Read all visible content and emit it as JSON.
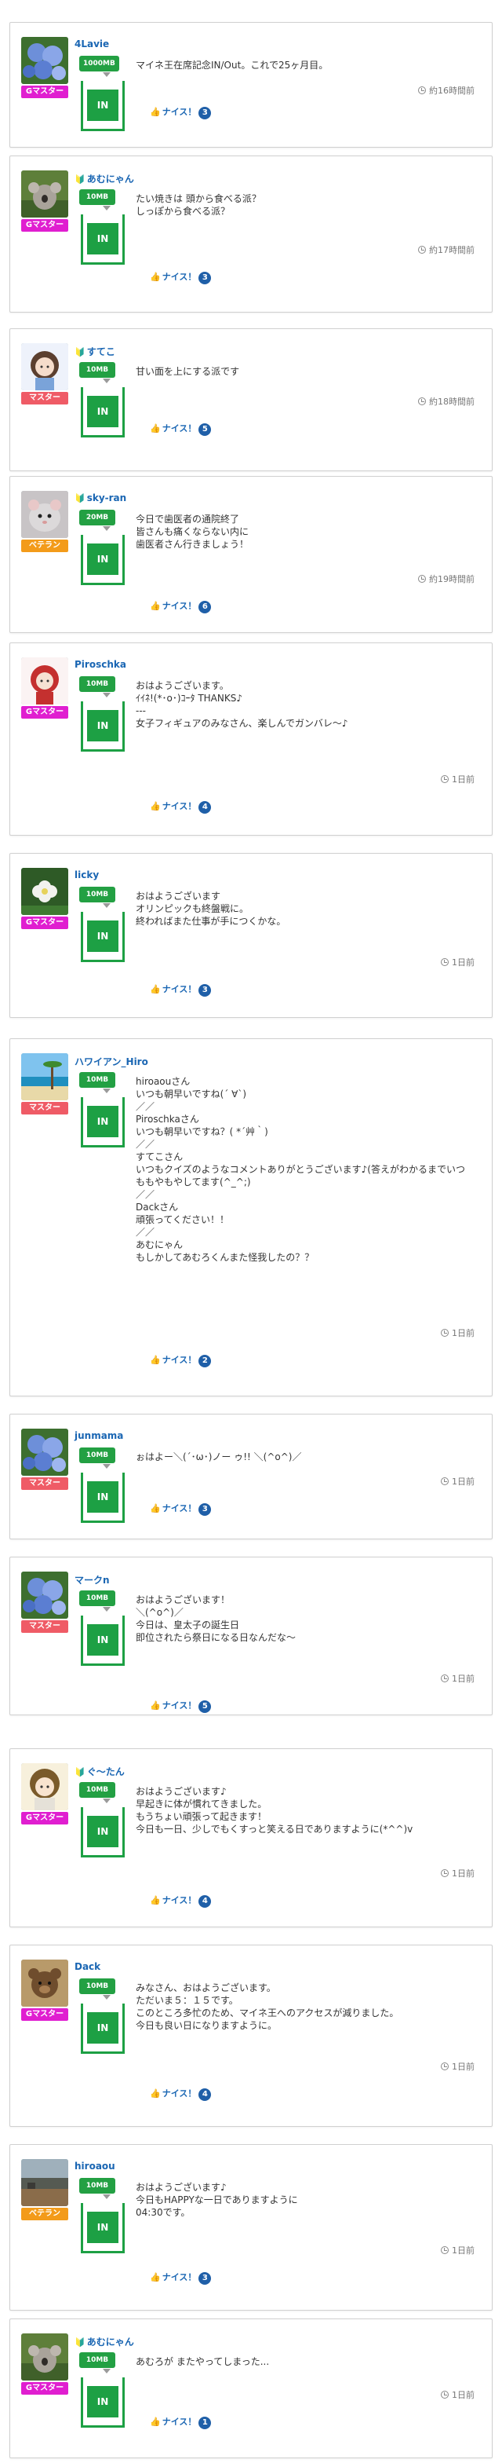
{
  "colors": {
    "in_green": "#1da044",
    "rank_gmaster": "#e01ed0",
    "rank_master": "#ef5b66",
    "rank_veteran": "#f39b1a",
    "link_blue": "#1a66b3"
  },
  "nice_label": "ナイス！",
  "in_label": "IN",
  "posts": [
    {
      "user": "4Lavie",
      "leaf": false,
      "rank": "Gマスター",
      "rank_type": "gmaster",
      "badge": "1000MB",
      "avatar": "hydrangea",
      "message": "マイネ王在席記念IN/Out。これで25ヶ月目。",
      "time": "約16時間前",
      "nice": "3"
    },
    {
      "user": "あむにゃん",
      "leaf": true,
      "rank": "Gマスター",
      "rank_type": "gmaster",
      "badge": "10MB",
      "avatar": "koala",
      "message": "たい焼きは 頭から食べる派？\nしっぽから食べる派？",
      "time": "約17時間前",
      "nice": "3"
    },
    {
      "user": "すてこ",
      "leaf": true,
      "rank": "マスター",
      "rank_type": "master",
      "badge": "10MB",
      "avatar": "girl",
      "message": "甘い面を上にする派です",
      "time": "約18時間前",
      "nice": "5"
    },
    {
      "user": "sky-ran",
      "leaf": true,
      "rank": "ベテラン",
      "rank_type": "veteran",
      "badge": "20MB",
      "avatar": "hamster",
      "message": "今日で歯医者の通院終了\n皆さんも痛くならない内に\n歯医者さん行きましょう！",
      "time": "約19時間前",
      "nice": "6"
    },
    {
      "user": "Piroschka",
      "leaf": false,
      "rank": "Gマスター",
      "rank_type": "gmaster",
      "badge": "10MB",
      "avatar": "doll",
      "message": "おはようございます。\nｲｲﾈ!(*･o･)ｺｰﾀ THANKS♪\n---\n女子フィギュアのみなさん、楽しんでガンバレ〜♪",
      "time": "1日前",
      "nice": "4"
    },
    {
      "user": "licky",
      "leaf": false,
      "rank": "Gマスター",
      "rank_type": "gmaster",
      "badge": "10MB",
      "avatar": "flower",
      "message": "おはようございます\nオリンピックも終盤戦に。\n終わればまた仕事が手につくかな。",
      "time": "1日前",
      "nice": "3"
    },
    {
      "user": "ハワイアン_Hiro",
      "leaf": false,
      "rank": "マスター",
      "rank_type": "master",
      "badge": "10MB",
      "avatar": "beach",
      "message": "hiroaouさん\nいつも朝早いですね(´ ∀`)\n／／\nPiroschkaさん\nいつも朝早いですね？( *´艸｀)\n／／\nすてこさん\nいつもクイズのようなコメントありがとうございます♪(答えがわかるまでいつももやもやしてます(^_^;)\n／／\nDackさん\n頑張ってください！！\n／／\nあむにゃん\nもしかしてあむろくんまた怪我したの？？",
      "time": "1日前",
      "nice": "2"
    },
    {
      "user": "junmama",
      "leaf": false,
      "rank": "マスター",
      "rank_type": "master",
      "badge": "10MB",
      "avatar": "hydrangea",
      "message": "ぉはよー＼(´･ω･)ノー ゥ!! ＼(^o^)／",
      "time": "1日前",
      "nice": "3"
    },
    {
      "user": "マークn",
      "leaf": false,
      "rank": "マスター",
      "rank_type": "master",
      "badge": "10MB",
      "avatar": "hydrangea",
      "message": "おはようございます！\n＼(^o^)／\n今日は、皇太子の誕生日\n即位されたら祭日になる日なんだな〜",
      "time": "1日前",
      "nice": "5"
    },
    {
      "user": "ぐ〜たん",
      "leaf": true,
      "rank": "Gマスター",
      "rank_type": "gmaster",
      "badge": "10MB",
      "avatar": "anime",
      "message": "おはようございます♪\n早起きに体が慣れてきました。\nもうちょい頑張って起きます！\n今日も一日、少しでもくすっと笑える日でありますように(*^^)v",
      "time": "1日前",
      "nice": "4"
    },
    {
      "user": "Dack",
      "leaf": false,
      "rank": "Gマスター",
      "rank_type": "gmaster",
      "badge": "10MB",
      "avatar": "bear",
      "message": "みなさん、おはようございます。\nただいま５：１５です。\nこのところ多忙のため、マイネ王へのアクセスが減りました。\n今日も良い日になりますように。",
      "time": "1日前",
      "nice": "4"
    },
    {
      "user": "hiroaou",
      "leaf": false,
      "rank": "ベテラン",
      "rank_type": "veteran",
      "badge": "10MB",
      "avatar": "landscape",
      "message": "おはようございます♪\n今日もHAPPYな一日でありますように\n04:30です。",
      "time": "1日前",
      "nice": "3"
    },
    {
      "user": "あむにゃん",
      "leaf": true,
      "rank": "Gマスター",
      "rank_type": "gmaster",
      "badge": "10MB",
      "avatar": "koala",
      "message": "あむろが またやってしまった...",
      "time": "1日前",
      "nice": "1"
    }
  ]
}
